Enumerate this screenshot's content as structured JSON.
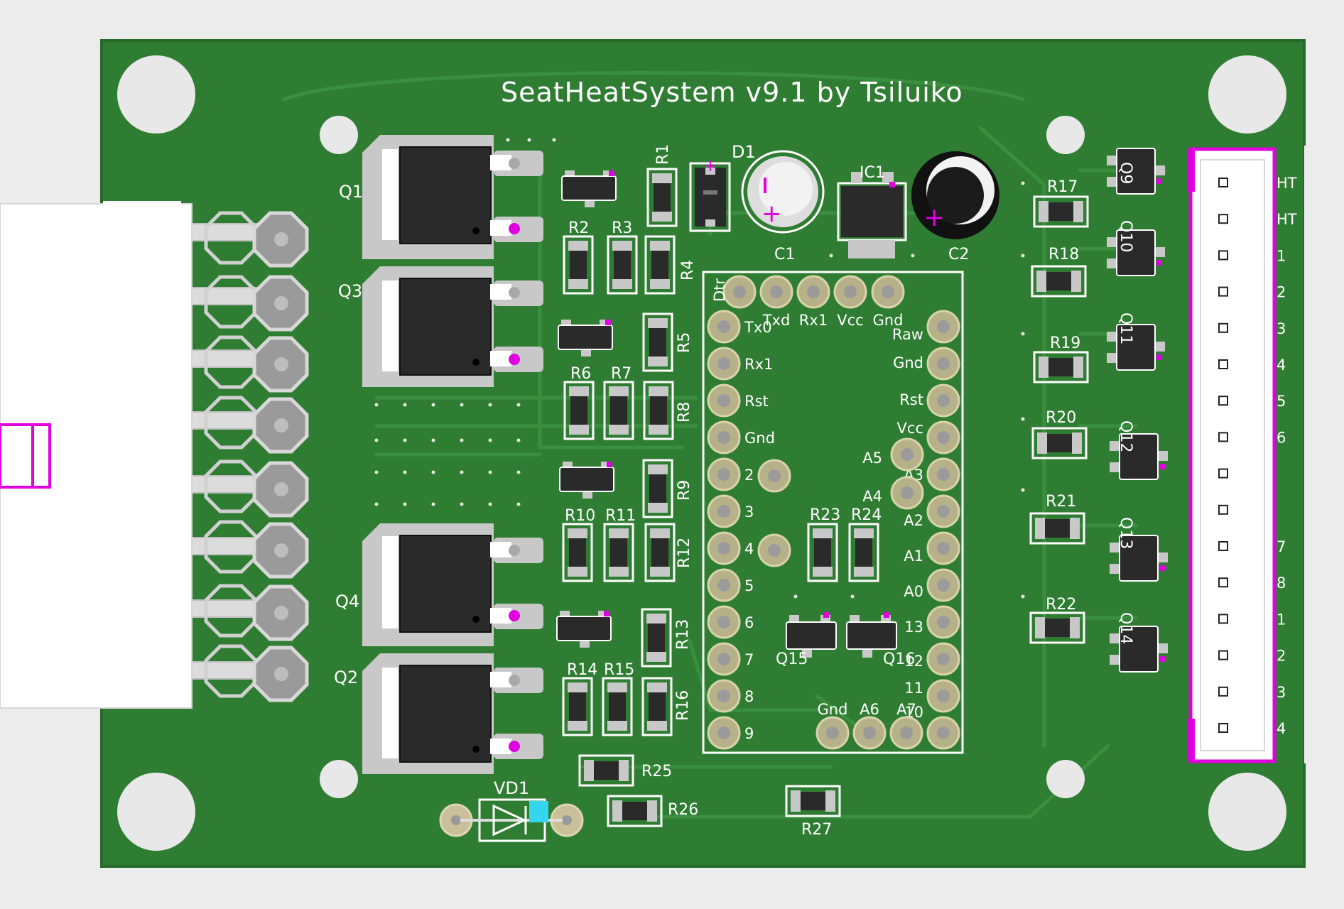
{
  "board": {
    "title": "SeatHeatSystem v9.1 by Tsiluiko",
    "colors": {
      "background": "#ececec",
      "pcb": "#2f7d32",
      "pcb_dark": "#266a29",
      "trace": "#3c9140",
      "pad": "#c9c9c9",
      "copper_pad": "#b7b18a",
      "silkscreen": "#ffffff",
      "package": "#2c2c2c",
      "marker": "#e000e0",
      "led": "#33d6ee",
      "connector": "#ffffff"
    }
  },
  "refs": {
    "q1": "Q1",
    "q2": "Q2",
    "q3": "Q3",
    "q4": "Q4",
    "d1": "D1",
    "c1": "C1",
    "c2": "C2",
    "ic1": "IC1",
    "vd1": "VD1",
    "r1": "R1",
    "r2": "R2",
    "r3": "R3",
    "r4": "R4",
    "r5": "R5",
    "r6": "R6",
    "r7": "R7",
    "r8": "R8",
    "r9": "R9",
    "r10": "R10",
    "r11": "R11",
    "r12": "R12",
    "r13": "R13",
    "r14": "R14",
    "r15": "R15",
    "r16": "R16",
    "r17": "R17",
    "r18": "R18",
    "r19": "R19",
    "r20": "R20",
    "r21": "R21",
    "r22": "R22",
    "r23": "R23",
    "r24": "R24",
    "r25": "R25",
    "r26": "R26",
    "r27": "R27",
    "q9": "Q9",
    "q10": "Q10",
    "q11": "Q11",
    "q12": "Q12",
    "q13": "Q13",
    "q14": "Q14",
    "q15": "Q15",
    "q16": "Q16"
  },
  "arduino": {
    "dtr": "Dtr",
    "top": [
      "Txd",
      "Rx1",
      "Vcc",
      "Gnd"
    ],
    "left": [
      "Tx0",
      "Rx1",
      "Rst",
      "Gnd",
      "2",
      "3",
      "4",
      "5",
      "6",
      "7",
      "8",
      "9"
    ],
    "right": [
      "Raw",
      "Gnd",
      "Rst",
      "Vcc",
      "A3",
      "A2",
      "A1",
      "A0",
      "13",
      "12",
      "11",
      "10"
    ],
    "inner": [
      "A5",
      "A4"
    ],
    "bottom": [
      "Gnd",
      "A6",
      "A7"
    ]
  },
  "connector_right": {
    "labels": [
      "HT",
      "HT",
      "1",
      "2",
      "3",
      "4",
      "5",
      "6",
      "",
      "",
      "7",
      "8",
      "1",
      "2",
      "3",
      "4"
    ]
  }
}
